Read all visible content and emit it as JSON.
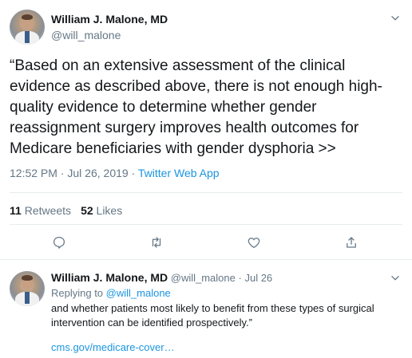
{
  "main_tweet": {
    "author_name": "William J. Malone, MD",
    "author_handle": "@will_malone",
    "text": "“Based on an extensive assessment of the clinical evidence as described above, there is not enough high-quality evidence to determine whether gender reassignment surgery improves health outcomes for Medicare beneficiaries with gender dysphoria >>",
    "time": "12:52 PM",
    "date": "Jul 26, 2019",
    "meta_separator": " · ",
    "source_app": "Twitter Web App",
    "retweets_count": "11",
    "retweets_label": "Retweets",
    "likes_count": "52",
    "likes_label": "Likes",
    "icons": [
      "reply-icon",
      "retweet-icon",
      "like-icon",
      "share-icon"
    ]
  },
  "reply_tweet": {
    "author_name": "William J. Malone, MD",
    "author_handle": "@will_malone",
    "separator": "·",
    "date": "Jul 26",
    "replying_to_label": "Replying to",
    "replying_to_handle": "@will_malone",
    "text": "and whether patients most likely to benefit from these types of surgical intervention can be identified prospectively.”",
    "link": "cms.gov/medicare-cover…"
  },
  "colors": {
    "text_primary": "#14171a",
    "text_secondary": "#657786",
    "link": "#1b95e0",
    "divider": "#e6ecf0"
  }
}
